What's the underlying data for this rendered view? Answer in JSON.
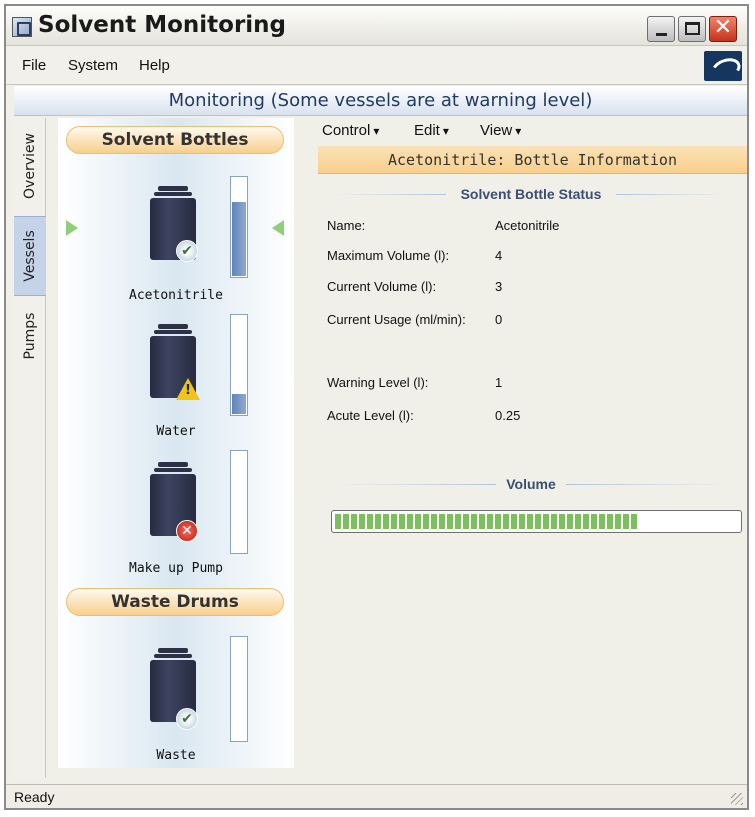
{
  "window": {
    "title": "Solvent Monitoring"
  },
  "menu": {
    "file": "File",
    "system": "System",
    "help": "Help"
  },
  "banner": {
    "text": "Monitoring (Some vessels are at warning level)"
  },
  "side_tabs": [
    "Overview",
    "Vessels",
    "Pumps"
  ],
  "solvent_bottles": {
    "header": "Solvent Bottles",
    "items": [
      {
        "label": "Acetonitrile",
        "status": "ok",
        "level": 0.75
      },
      {
        "label": "Water",
        "status": "warning",
        "level": 0.2
      },
      {
        "label": "Make up Pump",
        "status": "error",
        "level": 0
      }
    ]
  },
  "waste_drums": {
    "header": "Waste Drums",
    "items": [
      {
        "label": "Waste",
        "status": "ok",
        "level": 0
      }
    ]
  },
  "toolbar": {
    "control": "Control",
    "edit": "Edit",
    "view": "View"
  },
  "info": {
    "header": "Acetonitrile: Bottle Information",
    "status_title": "Solvent Bottle Status",
    "fields": [
      {
        "label": "Name:",
        "value": "Acetonitrile"
      },
      {
        "label": "Maximum Volume (l):",
        "value": "4"
      },
      {
        "label": "Current Volume (l):",
        "value": "3"
      },
      {
        "label": "Current Usage (ml/min):",
        "value": "0"
      },
      {
        "label": "Warning Level (l):",
        "value": "1"
      },
      {
        "label": "Acute Level (l):",
        "value": "0.25"
      }
    ],
    "volume_title": "Volume",
    "volume_fraction": 0.75
  },
  "statusbar": {
    "text": "Ready"
  },
  "colors": {
    "accent": "#1f3a66",
    "header_orange": "#f8cf8c",
    "level_blue": "#6f92c0",
    "progress_green": "#7bbf5f"
  }
}
